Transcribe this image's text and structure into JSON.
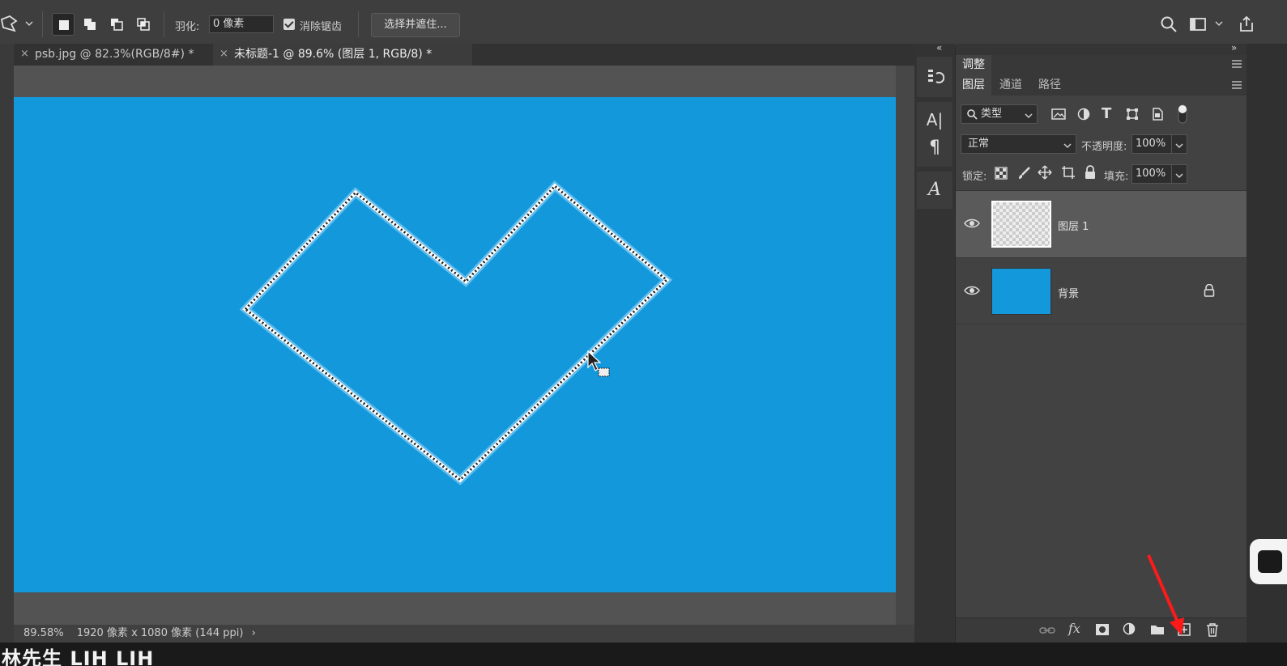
{
  "options_bar": {
    "feather_label": "羽化:",
    "feather_value": "0 像素",
    "antialias_label": "消除锯齿",
    "select_mask_button": "选择并遮住..."
  },
  "tabs": [
    {
      "close": "×",
      "label": "psb.jpg @ 82.3%(RGB/8#) *"
    },
    {
      "close": "×",
      "label": "未标题-1 @ 89.6% (图层 1, RGB/8) *"
    }
  ],
  "status": {
    "zoom": "89.58%",
    "doc_info": "1920 像素 x 1080 像素 (144 ppi)",
    "arrow": "›"
  },
  "watermark": "林先生 LIH LIH",
  "icon_column": {
    "char_icon": "A|",
    "para_icon": "¶",
    "glyph_icon": "A"
  },
  "panel": {
    "collapse_left": "«",
    "collapse_right": "»",
    "adjust_title": "调整",
    "tabs": [
      "图层",
      "通道",
      "路径"
    ],
    "filter_kind": "类型",
    "blend_mode": "正常",
    "opacity_label": "不透明度:",
    "opacity_value": "100%",
    "lock_label": "锁定:",
    "fill_label": "填充:",
    "fill_value": "100%",
    "layers": [
      {
        "name": "图层 1"
      },
      {
        "name": "背景"
      }
    ],
    "fx_label": "fx"
  },
  "colors": {
    "canvas": "#1498dc",
    "annotation_arrow": "#ff1a1a"
  }
}
